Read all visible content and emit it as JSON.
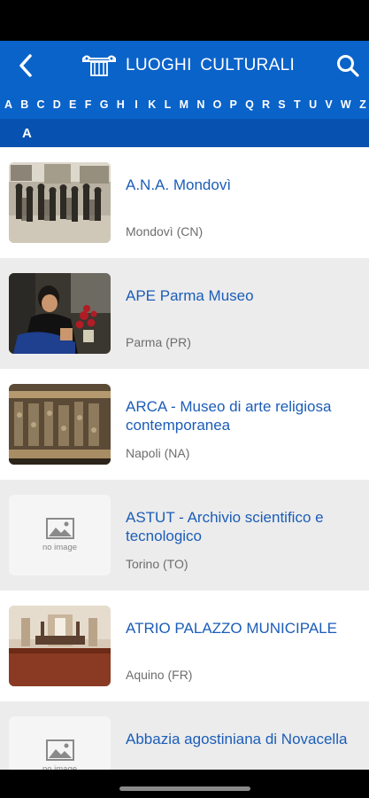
{
  "app_bar": {
    "title": "LUOGHI  CULTURALI",
    "accent": "#0a63c9"
  },
  "alphabet": [
    "A",
    "B",
    "C",
    "D",
    "E",
    "F",
    "G",
    "H",
    "I",
    "K",
    "L",
    "M",
    "N",
    "O",
    "P",
    "Q",
    "R",
    "S",
    "T",
    "U",
    "V",
    "W",
    "Z"
  ],
  "section": {
    "letter": "A"
  },
  "items": [
    {
      "title": "A.N.A. Mondovì",
      "location": "Mondovì (CN)",
      "image": "photo"
    },
    {
      "title": "APE Parma Museo",
      "location": "Parma (PR)",
      "image": "photo"
    },
    {
      "title": "ARCA - Museo di arte religiosa contemporanea",
      "location": "Napoli (NA)",
      "image": "photo"
    },
    {
      "title": "ASTUT - Archivio scientifico e tecnologico",
      "location": "Torino (TO)",
      "image": "no-image"
    },
    {
      "title": "ATRIO PALAZZO MUNICIPALE",
      "location": "Aquino (FR)",
      "image": "photo"
    },
    {
      "title": "Abbazia agostiniana di Novacella",
      "location": "",
      "image": "no-image"
    }
  ],
  "no_image_label": "no image"
}
